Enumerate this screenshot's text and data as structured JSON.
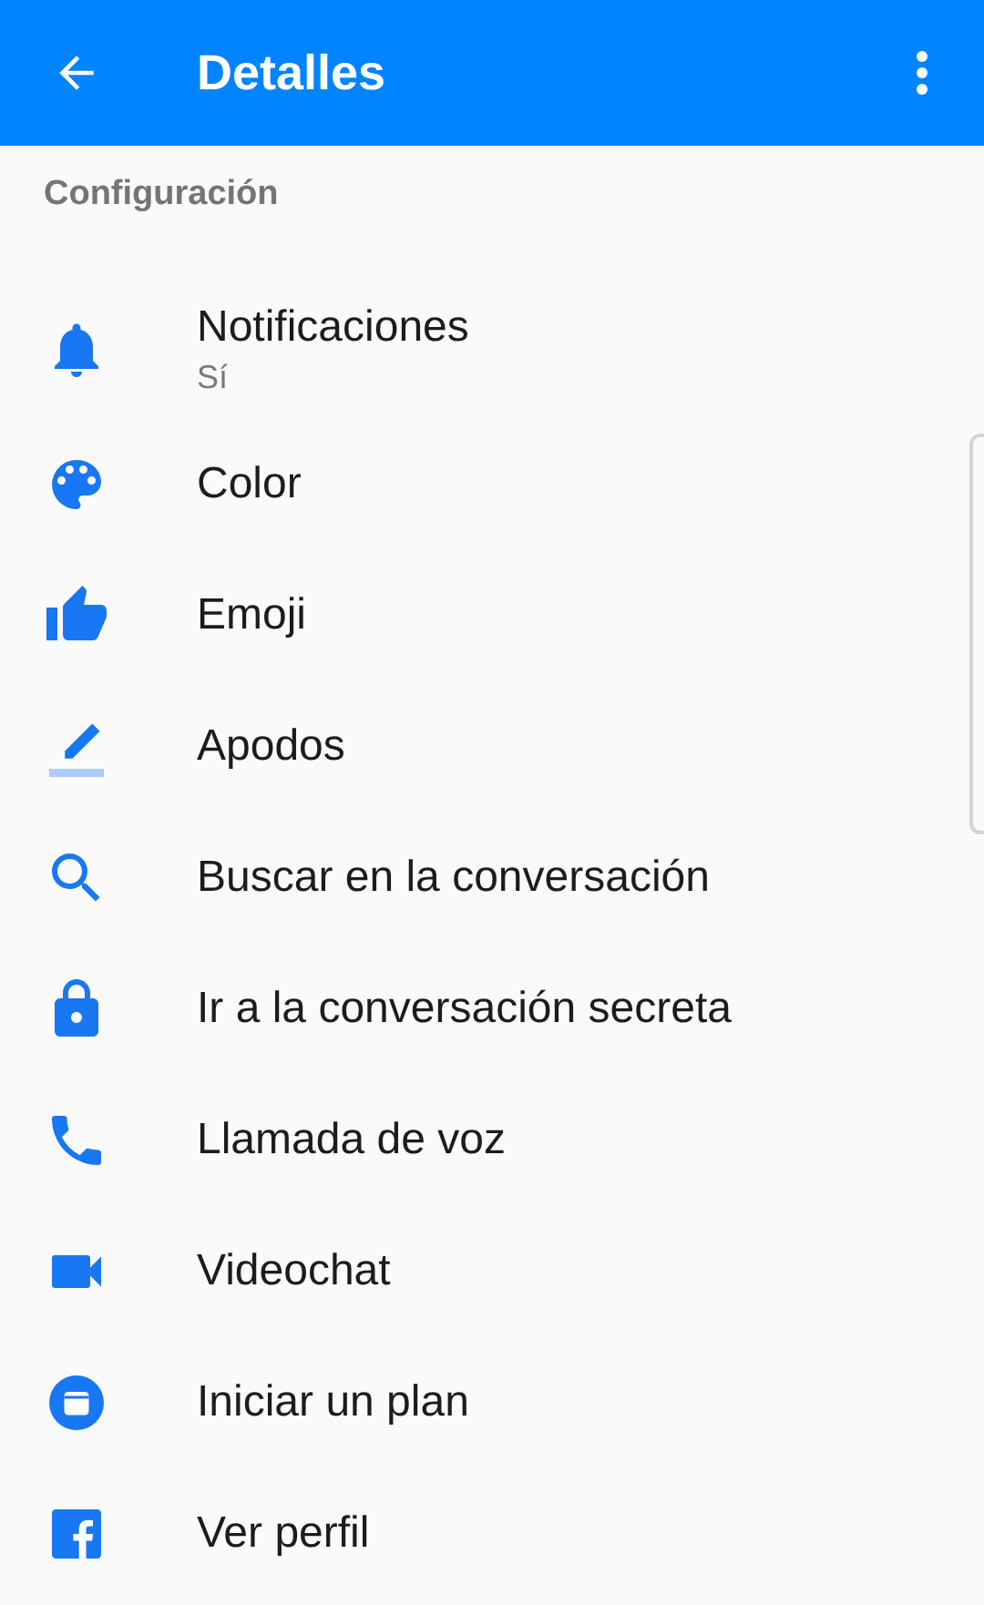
{
  "app_bar": {
    "title": "Detalles"
  },
  "section": {
    "title": "Configuración"
  },
  "items": [
    {
      "label": "Notificaciones",
      "subtitle": "Sí"
    },
    {
      "label": "Color"
    },
    {
      "label": "Emoji"
    },
    {
      "label": "Apodos"
    },
    {
      "label": "Buscar en la conversación"
    },
    {
      "label": "Ir a la conversación secreta"
    },
    {
      "label": "Llamada de voz"
    },
    {
      "label": "Videochat"
    },
    {
      "label": "Iniciar un plan"
    },
    {
      "label": "Ver perfil"
    }
  ]
}
